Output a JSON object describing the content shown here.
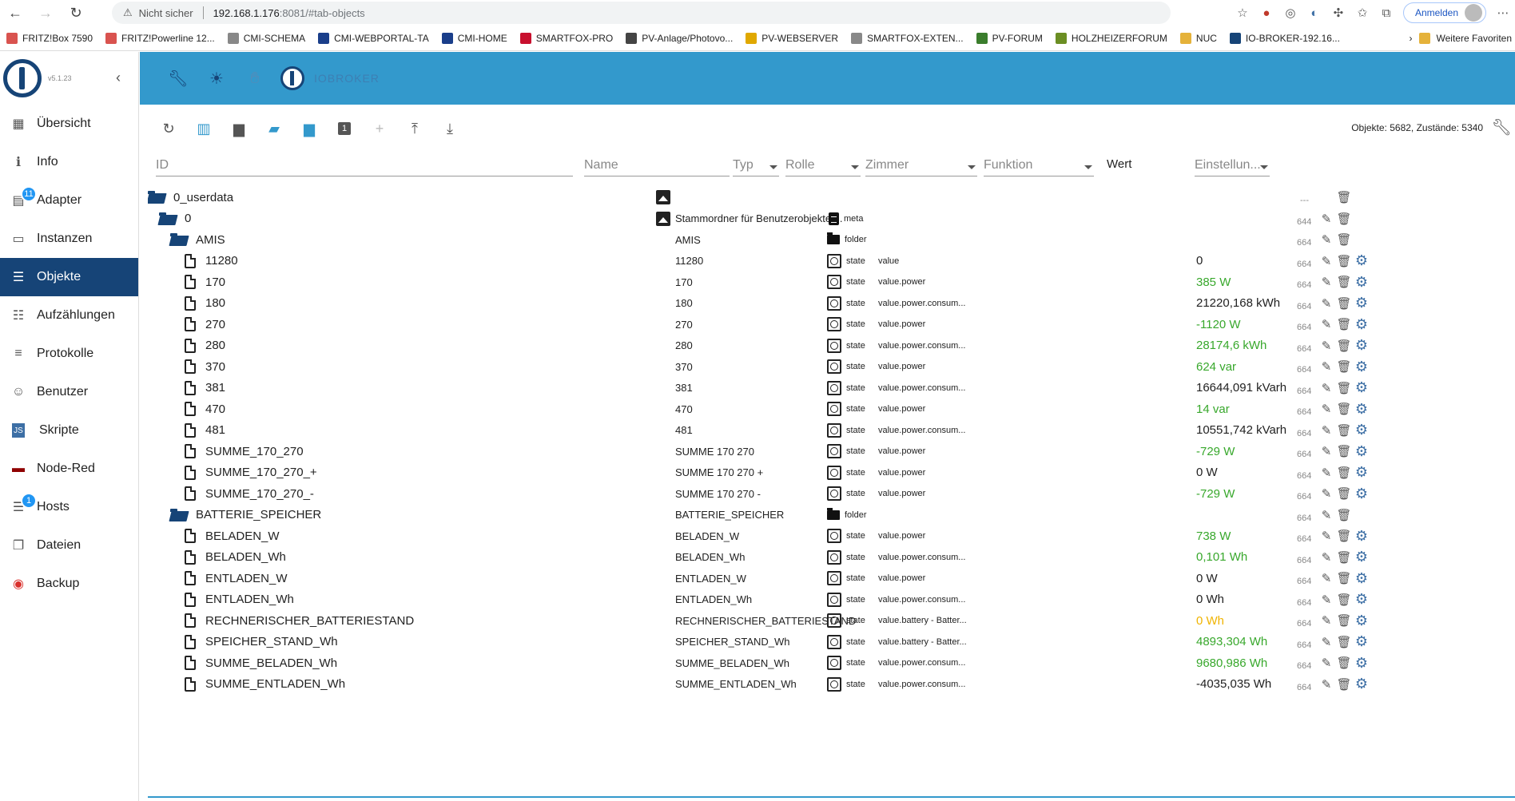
{
  "browser": {
    "security_label": "Nicht sicher",
    "url_host": "192.168.1.176",
    "url_path": ":8081/#tab-objects",
    "signin_label": "Anmelden"
  },
  "bookmarks": [
    {
      "label": "FRITZ!Box 7590",
      "color": "#d9534f"
    },
    {
      "label": "FRITZ!Powerline 12...",
      "color": "#d9534f"
    },
    {
      "label": "CMI-SCHEMA",
      "color": "#888888"
    },
    {
      "label": "CMI-WEBPORTAL-TA",
      "color": "#1a3e8a"
    },
    {
      "label": "CMI-HOME",
      "color": "#1a3e8a"
    },
    {
      "label": "SMARTFOX-PRO",
      "color": "#c8102e"
    },
    {
      "label": "PV-Anlage/Photovo...",
      "color": "#444444"
    },
    {
      "label": "PV-WEBSERVER",
      "color": "#e0a800"
    },
    {
      "label": "SMARTFOX-EXTEN...",
      "color": "#888888"
    },
    {
      "label": "PV-FORUM",
      "color": "#3a7d2c"
    },
    {
      "label": "HOLZHEIZERFORUM",
      "color": "#6b8e23"
    },
    {
      "label": "NUC",
      "color": "#e5b23a"
    },
    {
      "label": "IO-BROKER-192.16...",
      "color": "#164477"
    }
  ],
  "bookmarks_more": "Weitere Favoriten",
  "app": {
    "version": "v5.1.23",
    "title": "IOBROKER"
  },
  "sidebar": [
    {
      "label": "Übersicht",
      "icon": "grid-icon",
      "glyph": "▦",
      "badge": ""
    },
    {
      "label": "Info",
      "icon": "info-icon",
      "glyph": "ℹ",
      "badge": ""
    },
    {
      "label": "Adapter",
      "icon": "store-icon",
      "glyph": "▤",
      "badge": "11"
    },
    {
      "label": "Instanzen",
      "icon": "instances-icon",
      "glyph": "▭",
      "badge": ""
    },
    {
      "label": "Objekte",
      "icon": "list-icon",
      "glyph": "☰",
      "badge": "",
      "active": true
    },
    {
      "label": "Aufzählungen",
      "icon": "enum-icon",
      "glyph": "☷",
      "badge": ""
    },
    {
      "label": "Protokolle",
      "icon": "log-icon",
      "glyph": "≡",
      "badge": ""
    },
    {
      "label": "Benutzer",
      "icon": "user-icon",
      "glyph": "☺",
      "badge": ""
    },
    {
      "label": "Skripte",
      "icon": "script-icon",
      "glyph": "JS",
      "badge": ""
    },
    {
      "label": "Node-Red",
      "icon": "node-red-icon",
      "glyph": "▬",
      "badge": ""
    },
    {
      "label": "Hosts",
      "icon": "hosts-icon",
      "glyph": "☰",
      "badge": "1"
    },
    {
      "label": "Dateien",
      "icon": "files-icon",
      "glyph": "❐",
      "badge": ""
    },
    {
      "label": "Backup",
      "icon": "backup-icon",
      "glyph": "◉",
      "badge": ""
    }
  ],
  "toolbar": {
    "counts": "Objekte: 5682, Zustände: 5340"
  },
  "filters": {
    "id": "ID",
    "name": "Name",
    "type": "Typ",
    "role": "Rolle",
    "room": "Zimmer",
    "function": "Funktion",
    "value": "Wert",
    "settings": "Einstellun..."
  },
  "rows": [
    {
      "id": "0_userdata",
      "level": 0,
      "kind": "folder",
      "name": "",
      "type": "",
      "role": "",
      "value": "",
      "acl": "---",
      "edit": false,
      "gear": false,
      "image": true
    },
    {
      "id": "0",
      "level": 1,
      "kind": "folder",
      "name": "Stammordner für Benutzerobjekte ...",
      "type": "meta",
      "role": "",
      "value": "",
      "acl": "644",
      "edit": true,
      "gear": false,
      "image": true
    },
    {
      "id": "AMIS",
      "level": 2,
      "kind": "folder",
      "name": "AMIS",
      "type": "folder",
      "role": "",
      "value": "",
      "acl": "664",
      "edit": true,
      "gear": false
    },
    {
      "id": "11280",
      "level": 3,
      "kind": "file",
      "name": "11280",
      "type": "state",
      "role": "value",
      "value": "0",
      "color": "",
      "acl": "664",
      "edit": true,
      "gear": true
    },
    {
      "id": "170",
      "level": 3,
      "kind": "file",
      "name": "170",
      "type": "state",
      "role": "value.power",
      "value": "385 W",
      "color": "green",
      "acl": "664",
      "edit": true,
      "gear": true
    },
    {
      "id": "180",
      "level": 3,
      "kind": "file",
      "name": "180",
      "type": "state",
      "role": "value.power.consum...",
      "value": "21220,168 kWh",
      "color": "",
      "acl": "664",
      "edit": true,
      "gear": true
    },
    {
      "id": "270",
      "level": 3,
      "kind": "file",
      "name": "270",
      "type": "state",
      "role": "value.power",
      "value": "-1120 W",
      "color": "green",
      "acl": "664",
      "edit": true,
      "gear": true
    },
    {
      "id": "280",
      "level": 3,
      "kind": "file",
      "name": "280",
      "type": "state",
      "role": "value.power.consum...",
      "value": "28174,6 kWh",
      "color": "green",
      "acl": "664",
      "edit": true,
      "gear": true
    },
    {
      "id": "370",
      "level": 3,
      "kind": "file",
      "name": "370",
      "type": "state",
      "role": "value.power",
      "value": "624 var",
      "color": "green",
      "acl": "664",
      "edit": true,
      "gear": true
    },
    {
      "id": "381",
      "level": 3,
      "kind": "file",
      "name": "381",
      "type": "state",
      "role": "value.power.consum...",
      "value": "16644,091 kVarh",
      "color": "",
      "acl": "664",
      "edit": true,
      "gear": true
    },
    {
      "id": "470",
      "level": 3,
      "kind": "file",
      "name": "470",
      "type": "state",
      "role": "value.power",
      "value": "14 var",
      "color": "green",
      "acl": "664",
      "edit": true,
      "gear": true
    },
    {
      "id": "481",
      "level": 3,
      "kind": "file",
      "name": "481",
      "type": "state",
      "role": "value.power.consum...",
      "value": "10551,742 kVarh",
      "color": "",
      "acl": "664",
      "edit": true,
      "gear": true
    },
    {
      "id": "SUMME_170_270",
      "level": 3,
      "kind": "file",
      "name": "SUMME 170 270",
      "type": "state",
      "role": "value.power",
      "value": "-729 W",
      "color": "green",
      "acl": "664",
      "edit": true,
      "gear": true
    },
    {
      "id": "SUMME_170_270_+",
      "level": 3,
      "kind": "file",
      "name": "SUMME 170 270 +",
      "type": "state",
      "role": "value.power",
      "value": "0 W",
      "color": "",
      "acl": "664",
      "edit": true,
      "gear": true
    },
    {
      "id": "SUMME_170_270_-",
      "level": 3,
      "kind": "file",
      "name": "SUMME 170 270 -",
      "type": "state",
      "role": "value.power",
      "value": "-729 W",
      "color": "green",
      "acl": "664",
      "edit": true,
      "gear": true
    },
    {
      "id": "BATTERIE_SPEICHER",
      "level": 2,
      "kind": "folder",
      "name": "BATTERIE_SPEICHER",
      "type": "folder",
      "role": "",
      "value": "",
      "acl": "664",
      "edit": true,
      "gear": false
    },
    {
      "id": "BELADEN_W",
      "level": 3,
      "kind": "file",
      "name": "BELADEN_W",
      "type": "state",
      "role": "value.power",
      "value": "738 W",
      "color": "green",
      "acl": "664",
      "edit": true,
      "gear": true
    },
    {
      "id": "BELADEN_Wh",
      "level": 3,
      "kind": "file",
      "name": "BELADEN_Wh",
      "type": "state",
      "role": "value.power.consum...",
      "value": "0,101 Wh",
      "color": "green",
      "acl": "664",
      "edit": true,
      "gear": true
    },
    {
      "id": "ENTLADEN_W",
      "level": 3,
      "kind": "file",
      "name": "ENTLADEN_W",
      "type": "state",
      "role": "value.power",
      "value": "0 W",
      "color": "",
      "acl": "664",
      "edit": true,
      "gear": true
    },
    {
      "id": "ENTLADEN_Wh",
      "level": 3,
      "kind": "file",
      "name": "ENTLADEN_Wh",
      "type": "state",
      "role": "value.power.consum...",
      "value": "0 Wh",
      "color": "",
      "acl": "664",
      "edit": true,
      "gear": true
    },
    {
      "id": "RECHNERISCHER_BATTERIESTAND",
      "level": 3,
      "kind": "file",
      "name": "RECHNERISCHER_BATTERIESTAND",
      "type": "state",
      "role": "value.battery - Batter...",
      "value": "0 Wh",
      "color": "orange",
      "acl": "664",
      "edit": true,
      "gear": true
    },
    {
      "id": "SPEICHER_STAND_Wh",
      "level": 3,
      "kind": "file",
      "name": "SPEICHER_STAND_Wh",
      "type": "state",
      "role": "value.battery - Batter...",
      "value": "4893,304 Wh",
      "color": "green",
      "acl": "664",
      "edit": true,
      "gear": true
    },
    {
      "id": "SUMME_BELADEN_Wh",
      "level": 3,
      "kind": "file",
      "name": "SUMME_BELADEN_Wh",
      "type": "state",
      "role": "value.power.consum...",
      "value": "9680,986 Wh",
      "color": "green",
      "acl": "664",
      "edit": true,
      "gear": true
    },
    {
      "id": "SUMME_ENTLADEN_Wh",
      "level": 3,
      "kind": "file",
      "name": "SUMME_ENTLADEN_Wh",
      "type": "state",
      "role": "value.power.consum...",
      "value": "-4035,035 Wh",
      "color": "",
      "acl": "664",
      "edit": true,
      "gear": true
    }
  ]
}
